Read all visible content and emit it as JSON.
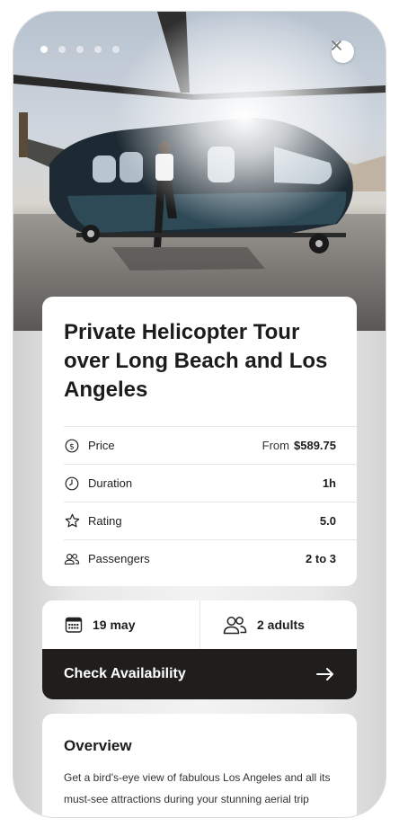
{
  "hero": {
    "image_subject": "helicopter",
    "slides": [
      true,
      false,
      false,
      false,
      false
    ],
    "close_icon": "close-icon"
  },
  "tour": {
    "title": "Private Helicopter Tour over Long Beach and Los Angeles",
    "details": [
      {
        "icon": "dollar-circle-icon",
        "label": "Price",
        "prefix": "From",
        "value": "$589.75"
      },
      {
        "icon": "clock-icon",
        "label": "Duration",
        "prefix": "",
        "value": "1h"
      },
      {
        "icon": "star-icon",
        "label": "Rating",
        "prefix": "",
        "value": "5.0"
      },
      {
        "icon": "users-icon",
        "label": "Passengers",
        "prefix": "",
        "value": "2 to 3"
      }
    ]
  },
  "booking": {
    "date": "19 may",
    "date_icon": "calendar-icon",
    "guests": "2 adults",
    "guests_icon": "users-icon",
    "cta_label": "Check Availability",
    "cta_icon": "arrow-right-icon"
  },
  "overview": {
    "heading": "Overview",
    "text": "Get a bird's-eye view of fabulous Los Angeles and all its must-see attractions during your stunning aerial trip"
  },
  "colors": {
    "accent": "#1f1e1d",
    "card": "#ffffff",
    "background": "#e9e9e9"
  }
}
